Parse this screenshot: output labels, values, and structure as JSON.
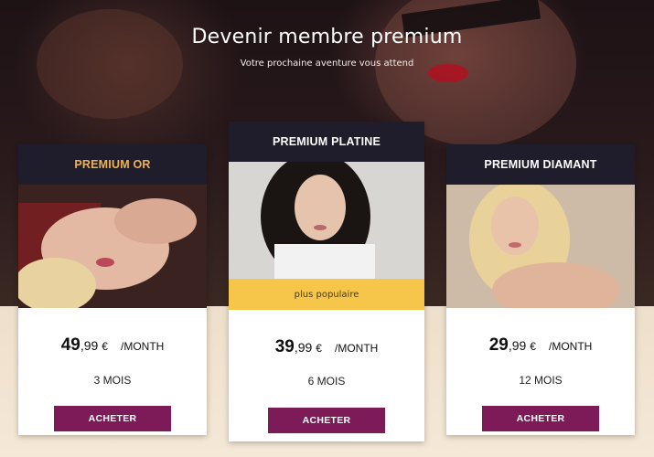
{
  "header": {
    "title": "Devenir membre premium",
    "subtitle": "Votre prochaine aventure vous attend"
  },
  "plans": [
    {
      "name": "PREMIUM OR",
      "name_color": "#f0b34a",
      "price_int": "49",
      "price_dec": ",99",
      "currency": "€",
      "period": "/MONTH",
      "duration": "3 MOIS",
      "button": "ACHETER"
    },
    {
      "name": "PREMIUM PLATINE",
      "badge": "plus populaire",
      "price_int": "39",
      "price_dec": ",99",
      "currency": "€",
      "period": "/MONTH",
      "duration": "6 MOIS",
      "button": "ACHETER"
    },
    {
      "name": "PREMIUM DIAMANT",
      "price_int": "29",
      "price_dec": ",99",
      "currency": "€",
      "period": "/MONTH",
      "duration": "12 MOIS",
      "button": "ACHETER"
    }
  ],
  "colors": {
    "header_bg": "#1f1c2c",
    "gold": "#f0b34a",
    "badge_bg": "#f6c64a",
    "button_bg": "#7d1b58"
  }
}
